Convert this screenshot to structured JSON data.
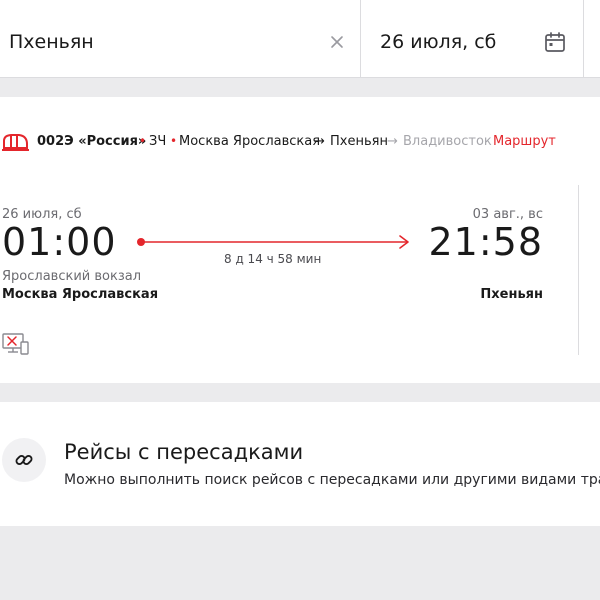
{
  "search": {
    "destination": "Пхеньян",
    "date": "26 июля, сб"
  },
  "train": {
    "number": "002Э «Россия»",
    "car_class": "ЗЧ",
    "route_from": "Москва Ярославская",
    "route_arrow_1": "→",
    "route_to": "Пхеньян",
    "route_arrow_2": "→",
    "route_final": "Владивосток",
    "route_link": "Маршрут",
    "departure": {
      "date": "26 июля, сб",
      "time": "01:00",
      "station_sub": "Ярославский вокзал",
      "station": "Москва Ярославская"
    },
    "arrival": {
      "date": "03 авг., вс",
      "time": "21:58",
      "station": "Пхеньян"
    },
    "duration": "8 д 14 ч 58 мин"
  },
  "transfers": {
    "title": "Рейсы с пересадками",
    "description": "Можно выполнить поиск рейсов с пересадками или другими видами тран"
  },
  "colors": {
    "accent": "#e4262c",
    "background": "#ebebed"
  },
  "icons": {
    "clear": "close-icon",
    "calendar": "calendar-icon",
    "train": "train-logo-icon",
    "no_eticket": "no-eticket-icon",
    "transfers": "link-icon"
  }
}
